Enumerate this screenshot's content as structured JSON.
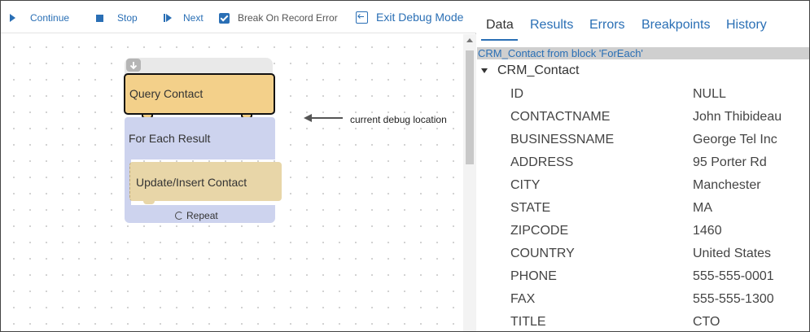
{
  "toolbar": {
    "continue_label": "Continue",
    "stop_label": "Stop",
    "next_label": "Next",
    "break_label": "Break On Record Error",
    "break_checked": true,
    "exit_label": "Exit Debug Mode"
  },
  "canvas": {
    "blocks": {
      "query": "Query Contact",
      "foreach": "For Each Result",
      "update": "Update/Insert Contact",
      "repeat": "Repeat"
    },
    "debug_location_label": "current debug location"
  },
  "panel": {
    "tabs": [
      {
        "label": "Data",
        "active": true
      },
      {
        "label": "Results",
        "active": false
      },
      {
        "label": "Errors",
        "active": false
      },
      {
        "label": "Breakpoints",
        "active": false
      },
      {
        "label": "History",
        "active": false
      }
    ],
    "block_header": "CRM_Contact from block 'ForEach'",
    "tree_root": "CRM_Contact",
    "rows": [
      {
        "key": "ID",
        "value": "NULL"
      },
      {
        "key": "CONTACTNAME",
        "value": "John Thibideau"
      },
      {
        "key": "BUSINESSNAME",
        "value": "George Tel Inc"
      },
      {
        "key": "ADDRESS",
        "value": "95 Porter Rd"
      },
      {
        "key": "CITY",
        "value": "Manchester"
      },
      {
        "key": "STATE",
        "value": "MA"
      },
      {
        "key": "ZIPCODE",
        "value": "1460"
      },
      {
        "key": "COUNTRY",
        "value": "United States"
      },
      {
        "key": "PHONE",
        "value": "555-555-0001"
      },
      {
        "key": "FAX",
        "value": "555-555-1300"
      },
      {
        "key": "TITLE",
        "value": "CTO"
      }
    ]
  },
  "colors": {
    "accent": "#2a6fb5",
    "query_block": "#f3d08a",
    "foreach_block": "#cdd3ee",
    "update_block": "#e8d6a8"
  }
}
